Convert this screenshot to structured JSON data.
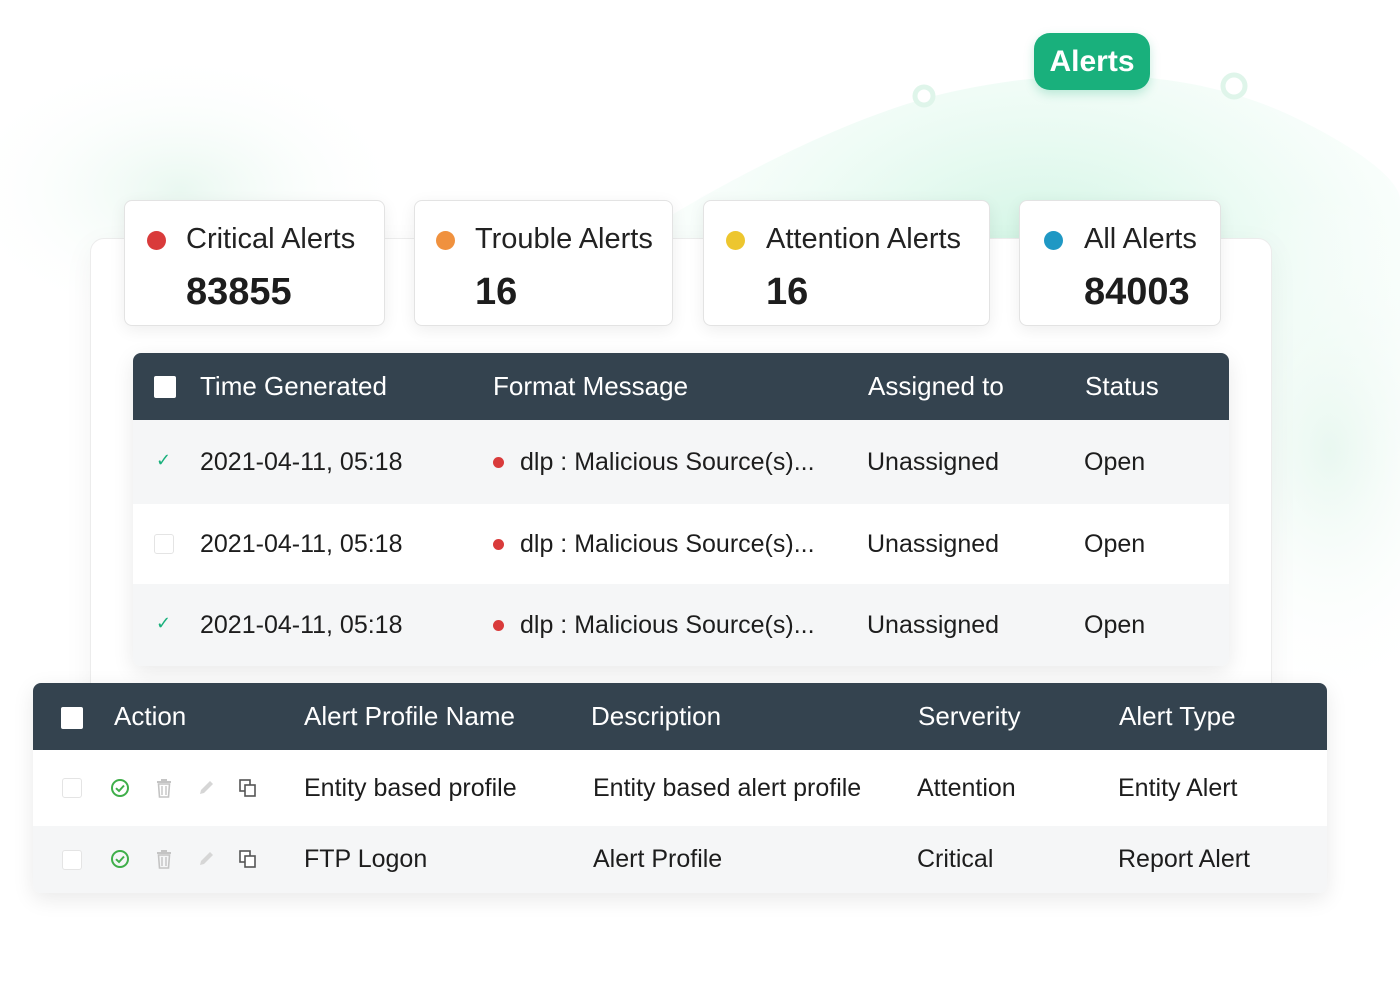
{
  "header": {
    "badge_label": "Alerts",
    "accent_color": "#19b07c"
  },
  "stats": [
    {
      "label": "Critical Alerts",
      "value": "83855",
      "color": "#d93b3b"
    },
    {
      "label": "Trouble Alerts",
      "value": "16",
      "color": "#f0913e"
    },
    {
      "label": "Attention Alerts",
      "value": "16",
      "color": "#edc62e"
    },
    {
      "label": "All Alerts",
      "value": "84003",
      "color": "#1f98c4"
    }
  ],
  "alerts_table": {
    "columns": [
      "Time Generated",
      "Format Message",
      "Assigned to",
      "Status"
    ],
    "rows": [
      {
        "checked": true,
        "time": "2021-04-11, 05:18",
        "message": "dlp : Malicious Source(s)...",
        "assigned": "Unassigned",
        "status": "Open"
      },
      {
        "checked": false,
        "time": "2021-04-11, 05:18",
        "message": "dlp : Malicious Source(s)...",
        "assigned": "Unassigned",
        "status": "Open"
      },
      {
        "checked": true,
        "time": "2021-04-11, 05:18",
        "message": "dlp : Malicious Source(s)...",
        "assigned": "Unassigned",
        "status": "Open"
      }
    ]
  },
  "profiles_table": {
    "columns": [
      "Action",
      "Alert Profile Name",
      "Description",
      "Serverity",
      "Alert Type"
    ],
    "action_icons": [
      "enable-icon",
      "trash-icon",
      "pencil-icon",
      "copy-icon"
    ],
    "rows": [
      {
        "name": "Entity based profile",
        "description": "Entity based alert profile",
        "severity": "Attention",
        "type": "Entity Alert"
      },
      {
        "name": "FTP Logon",
        "description": "Alert Profile",
        "severity": "Critical",
        "type": "Report Alert"
      }
    ]
  }
}
